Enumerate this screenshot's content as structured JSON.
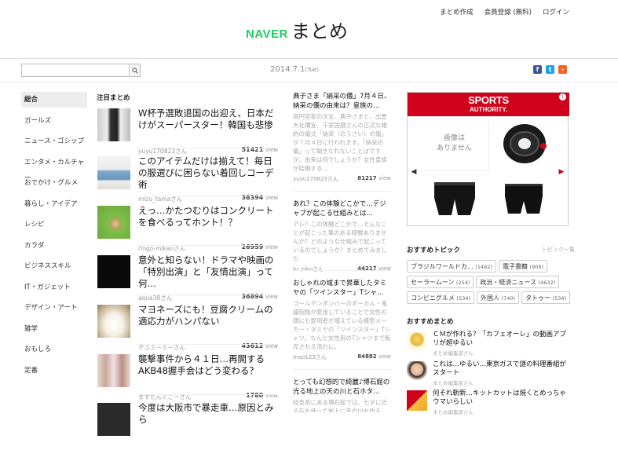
{
  "header": {
    "links": [
      "まとめ作成",
      "会員登録 (無料)",
      "ログイン"
    ],
    "logo_brand": "NAVER",
    "logo_title": "まとめ"
  },
  "search": {
    "placeholder": "",
    "value": ""
  },
  "date": {
    "day": "2014.7.1",
    "weekday": "(Tue)"
  },
  "social": [
    "facebook-icon",
    "twitter-icon",
    "rss-icon"
  ],
  "categories": [
    "総合",
    "ガールズ",
    "ニュース・ゴシップ",
    "エンタメ・カルチャー",
    "おでかけ・グルメ",
    "暮らし・アイデア",
    "レシピ",
    "カラダ",
    "ビジネススキル",
    "IT・ガジェット",
    "デザイン・アート",
    "雑学",
    "おもしろ",
    "定番"
  ],
  "main": {
    "section_title": "注目まとめ",
    "view_suffix": "view",
    "items": [
      {
        "title": "W杯予選敗退国の出迎え、日本だけがスーパースター！韓国も悲惨",
        "user": "yuyu170823さん",
        "views": "51421"
      },
      {
        "title": "このアイテムだけは揃えて！毎日の服選びに困らない着回しコーデ術",
        "user": "mizu_tamaさん",
        "views": "38394"
      },
      {
        "title": "えっ…かたつむりはコンクリートを食べるってホント！？",
        "user": "ringo-mikanさん",
        "views": "26959"
      },
      {
        "title": "意外と知らない！ドラマや映画の「特別出演」と「友情出演」って何…",
        "user": "aqua38さん",
        "views": "36894"
      },
      {
        "title": "マヨネーズにも！豆腐クリームの適応力がハンパない",
        "user": "チユミーミーさん",
        "views": "43612"
      },
      {
        "title": "襲撃事件から４１日…再開するAKB48握手会はどう変わる？",
        "user": "ますたんぐごーさん",
        "views": "1780"
      },
      {
        "title": "今度は大阪市で暴走車…原因とみら",
        "user": "",
        "views": ""
      }
    ]
  },
  "col2": {
    "items": [
      {
        "title": "典子さま「納采の儀」7月４日、納采の儀の由来は？皇族の…",
        "desc": "高円宮家の次女、典子さまと、出雲大社禰宜、千家国麿さんの正式な婚約の儀式「納采（のうさい）の儀」が７月４日に行われます。「納采の儀」って聞きなれないことばですが、由来は何でしょうか？女性皇族が結婚する…",
        "user": "yuyu170823さん",
        "views": "81217"
      },
      {
        "title": "あれ？この体験どこかで…デジャブが起こる仕組みとは…",
        "desc": "アレ？この体験どこかで…そんなことが起こった事のある経験ありませんか？どのような仕組みで起こっているのでしょうか？まとめてみました",
        "user": "bc.pikoさん",
        "views": "44217"
      },
      {
        "title": "おしゃれの域まで昇華したタミヤの「ツインスター」Tシャ…",
        "desc": "ゴールデンボンバーのボーカル・鬼龍院翔が愛用していることで女性の間にも愛用者が増えている模型メーカー・タミヤの「ツインスター」Tシャツ。なんと女性用のTシャツまで販売される流れに。",
        "user": "mao123さん",
        "views": "84882"
      },
      {
        "title": "とっても幻想的で綺麗♪博石館の光る地上の天の川と石ホタ…",
        "desc": "岐阜県にある博石館では、七夕に光る石を使って地上に天の川を作る…",
        "user": "",
        "views": ""
      }
    ]
  },
  "ad": {
    "brand_line1": "SPORTS",
    "brand_line2": "AUTHORITY.",
    "info": "i",
    "no_image": "画像は\nありません"
  },
  "topics": {
    "title": "おすすめトピック",
    "more": "トピック一覧",
    "tags": [
      {
        "name": "ブラジルワールドカ…",
        "count": "(1462)"
      },
      {
        "name": "電子書籍",
        "count": "(909)"
      },
      {
        "name": "セーラームーン",
        "count": "(254)"
      },
      {
        "name": "政治・経済ニュース",
        "count": "(4632)"
      },
      {
        "name": "コンビニグルメ",
        "count": "(534)"
      },
      {
        "name": "外国人",
        "count": "(740)"
      },
      {
        "name": "タトゥー",
        "count": "(534)"
      }
    ]
  },
  "recommended": {
    "title": "おすすめまとめ",
    "items": [
      {
        "title": "ＣＭが作れる？「カフェオーレ」の動画アプリが超ゆるい",
        "user": "まとめ編集部さん"
      },
      {
        "title": "これは…ゆるい…東京ガスで謎の料理番組がスタート",
        "user": "まとめ編集部さん"
      },
      {
        "title": "何それ斬新…キットカットは焼くとめっちゃウマいらしい",
        "user": "まとめ編集部さん"
      }
    ]
  },
  "colors": {
    "brand_green": "#19ce60",
    "ad_red": "#d0021b",
    "facebook": "#3b5998",
    "twitter": "#1da1f2",
    "rss": "#f26522"
  }
}
